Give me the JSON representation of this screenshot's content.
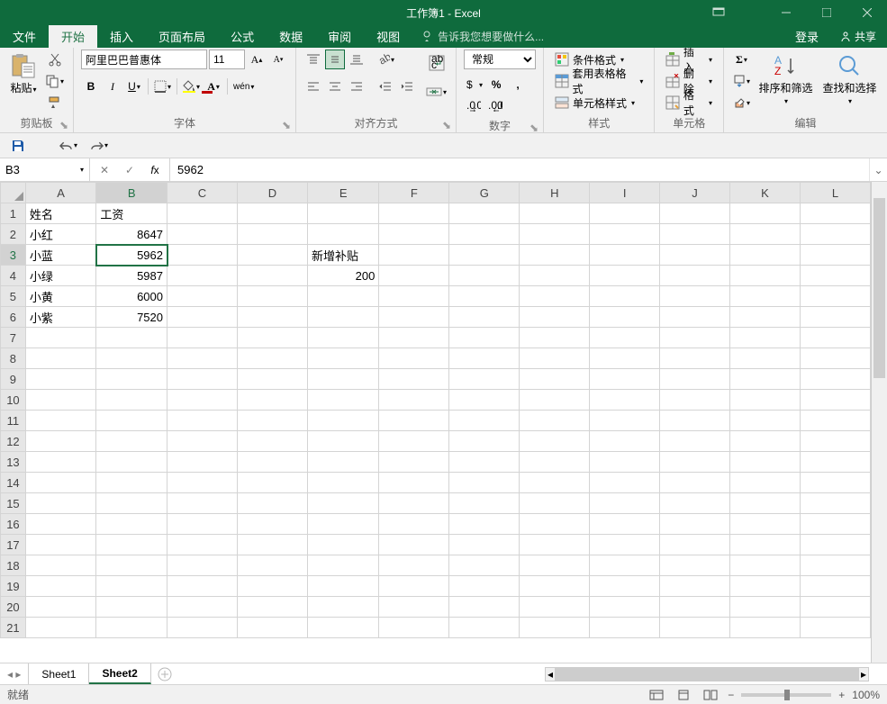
{
  "title": "工作簿1 - Excel",
  "menu": {
    "file": "文件",
    "home": "开始",
    "insert": "插入",
    "layout": "页面布局",
    "formula": "公式",
    "data": "数据",
    "review": "审阅",
    "view": "视图",
    "tell": "告诉我您想要做什么...",
    "login": "登录",
    "share": "共享"
  },
  "ribbon": {
    "clipboard": {
      "paste": "粘贴",
      "label": "剪贴板"
    },
    "font": {
      "name": "阿里巴巴普惠体",
      "size": "11",
      "label": "字体"
    },
    "align": {
      "label": "对齐方式"
    },
    "number": {
      "format": "常规",
      "label": "数字"
    },
    "styles": {
      "cond": "条件格式",
      "table": "套用表格格式",
      "cell": "单元格样式",
      "label": "样式"
    },
    "cells": {
      "insert": "插入",
      "delete": "删除",
      "format": "格式",
      "label": "单元格"
    },
    "editing": {
      "sort": "排序和筛选",
      "find": "查找和选择",
      "label": "编辑"
    }
  },
  "namebox": "B3",
  "formula": "5962",
  "cols": [
    "A",
    "B",
    "C",
    "D",
    "E",
    "F",
    "G",
    "H",
    "I",
    "J",
    "K",
    "L"
  ],
  "rows": 21,
  "cells": {
    "A1": "姓名",
    "B1": "工资",
    "A2": "小红",
    "B2": "8647",
    "A3": "小蓝",
    "B3": "5962",
    "E3": "新增补贴",
    "A4": "小绿",
    "B4": "5987",
    "E4": "200",
    "A5": "小黄",
    "B5": "6000",
    "A6": "小紫",
    "B6": "7520"
  },
  "selected": "B3",
  "sheets": {
    "s1": "Sheet1",
    "s2": "Sheet2"
  },
  "status": {
    "ready": "就绪",
    "zoom": "100%"
  }
}
